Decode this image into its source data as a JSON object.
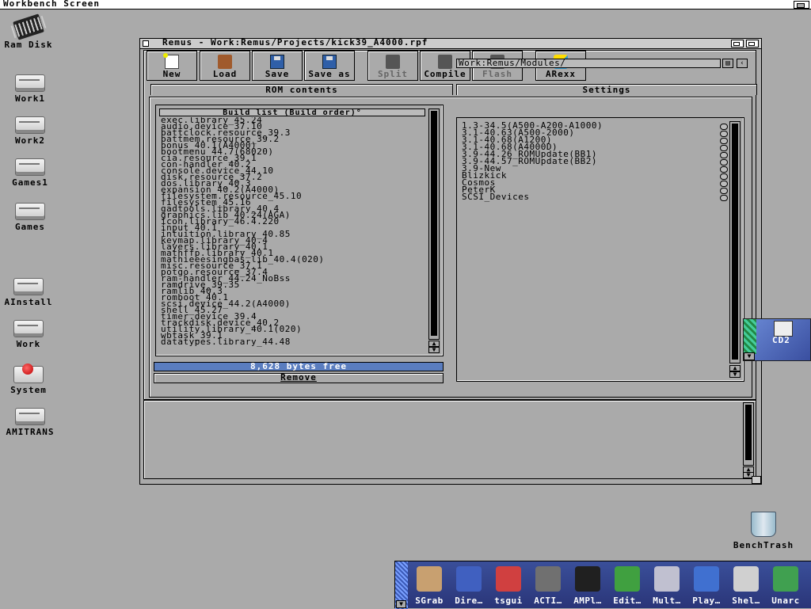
{
  "screen": {
    "title": "Workbench Screen"
  },
  "desktop_icons": [
    {
      "label": "Ram Disk",
      "icon": "chip-icon"
    },
    {
      "label": "Work1",
      "icon": "drive-icon"
    },
    {
      "label": "Work2",
      "icon": "drive-icon"
    },
    {
      "label": "Games1",
      "icon": "drive-icon"
    },
    {
      "label": "Games",
      "icon": "drive-icon"
    },
    {
      "label": "AInstall",
      "icon": "drive-icon"
    },
    {
      "label": "Work",
      "icon": "drive-icon"
    },
    {
      "label": "System",
      "icon": "system-drive-icon"
    },
    {
      "label": "AMITRANS",
      "icon": "drive-icon"
    }
  ],
  "window": {
    "title": "Remus - Work:Remus/Projects/kick39_A4000.rpf",
    "toolbar": [
      {
        "label": "New",
        "icon": "new-icon",
        "enabled": true
      },
      {
        "label": "Load",
        "icon": "load-icon",
        "enabled": true
      },
      {
        "label": "Save",
        "icon": "save-icon",
        "enabled": true
      },
      {
        "label": "Save as",
        "icon": "save-as-icon",
        "enabled": true
      },
      {
        "label": "Split",
        "icon": "split-icon",
        "enabled": false
      },
      {
        "label": "Compile",
        "icon": "compile-icon",
        "enabled": true
      },
      {
        "label": "Flash",
        "icon": "flash-icon",
        "enabled": false
      },
      {
        "label": "ARexx",
        "icon": "arexx-icon",
        "enabled": true
      }
    ],
    "tabs": [
      {
        "label": "ROM contents",
        "active": true
      },
      {
        "label": "Settings",
        "active": false
      }
    ],
    "build_list": {
      "header": "Build list (Build order)",
      "header_marker": "°",
      "items": [
        "exec.library_45.24",
        "audio.device_37.10",
        "battclock.resource_39.3",
        "battmem.resource_39.2",
        "bonus_40.1(A4000)",
        "bootmenu_44.7(68020)",
        "cia.resource_39.1",
        "con-handler_40.2",
        "console.device_44.10",
        "disk.resource_37.2",
        "dos.library_40.3",
        "expansion_40.2(A4000)",
        "filesystem.resource_45.10",
        "filesystem_45.16",
        "gadtools.library_40.4",
        "graphics.lib_40.24(AGA)",
        "icon.library_46.4.220",
        "input_40.1",
        "intuition.library_40.85",
        "keymap.library_40.4",
        "layers.library_40.1",
        "mathffp.library_40.1",
        "mathieeesingbas.lib_40.4(020)",
        "misc.resource_37.1",
        "potgo.resource_37.4",
        "ram-handler_44.24_NoBss",
        "ramdrive_39.35",
        "ramlib_40.3",
        "romboot_40.1",
        "scsi.device_44.2(A4000)",
        "shell_45.27",
        "timer.device_39.4",
        "trackdisk.device_40.2",
        "utility.library_40.1(020)",
        "wbtask_39.1",
        "datatypes.library_44.48"
      ],
      "free_text": "8,628 bytes free",
      "remove_label": "Remove"
    },
    "modules": {
      "path": "Work:Remus/Modules/",
      "items": [
        "1.3-34.5(A500-A200-A1000)",
        "3.1-40.63(A500-2000)",
        "3.1-40.68(A1200)",
        "3.1-40.68(A4000D)",
        "3.9-44.26_ROMUpdate(BB1)",
        "3.9-44.57_ROMUpdate(BB2)",
        "3.9-New",
        "Blizkick",
        "Cosmos",
        "PeterK",
        "SCSI_Devices"
      ]
    }
  },
  "cd_icon": {
    "label": "CD2"
  },
  "trash": {
    "label": "BenchTrash"
  },
  "dock": {
    "items": [
      {
        "label": "SGrab",
        "icon": "sgrab-icon",
        "color": "#c8a070"
      },
      {
        "label": "Dire…",
        "icon": "directory-opus-icon",
        "color": "#4060c0"
      },
      {
        "label": "tsgui",
        "icon": "tsgui-icon",
        "color": "#d04040"
      },
      {
        "label": "ACTI…",
        "icon": "activity-icon",
        "color": "#707070"
      },
      {
        "label": "AMPl…",
        "icon": "amplifier-icon",
        "color": "#202020"
      },
      {
        "label": "Edit…",
        "icon": "editor-icon",
        "color": "#40a040"
      },
      {
        "label": "Mult…",
        "icon": "magnifier-icon",
        "color": "#c0c0d0"
      },
      {
        "label": "Play…",
        "icon": "player-icon",
        "color": "#4070d0"
      },
      {
        "label": "Shel…",
        "icon": "shell-icon",
        "color": "#d0d0d0"
      },
      {
        "label": "Unarc",
        "icon": "unarc-icon",
        "color": "#40a050"
      }
    ]
  }
}
